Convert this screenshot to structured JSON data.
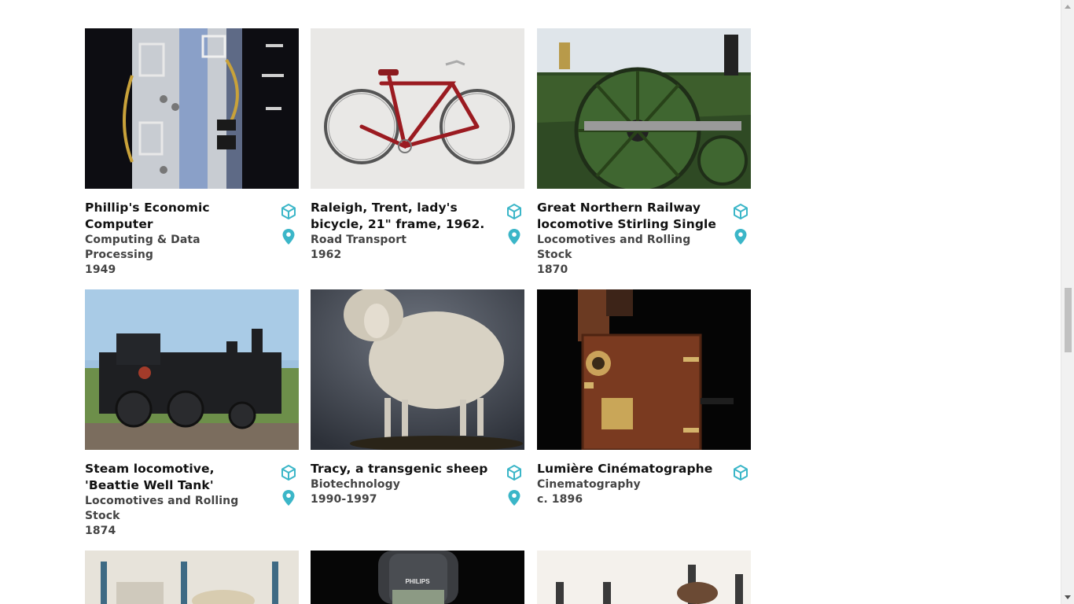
{
  "accent_color": "#3bb6c8",
  "cards": [
    {
      "title": "Phillip's Economic Computer",
      "category": "Computing & Data Processing",
      "date": "1949",
      "has_3d": true,
      "has_location": true
    },
    {
      "title": "Raleigh, Trent, lady's bicycle, 21\" frame, 1962.",
      "category": "Road Transport",
      "date": "1962",
      "has_3d": true,
      "has_location": true
    },
    {
      "title": "Great Northern Railway locomotive Stirling Single",
      "category": "Locomotives and Rolling Stock",
      "date": "1870",
      "has_3d": true,
      "has_location": true
    },
    {
      "title": "Steam locomotive, 'Beattie Well Tank'",
      "category": "Locomotives and Rolling Stock",
      "date": "1874",
      "has_3d": true,
      "has_location": true
    },
    {
      "title": "Tracy, a transgenic sheep",
      "category": "Biotechnology",
      "date": "1990-1997",
      "has_3d": true,
      "has_location": true
    },
    {
      "title": "Lumière Cinématographe",
      "category": "Cinematography",
      "date": "c. 1896",
      "has_3d": true,
      "has_location": false
    }
  ],
  "partial_cards": [
    {
      "image_text": "PHILIPS"
    }
  ],
  "icons": {
    "view_3d": "cube-3d-icon",
    "location": "map-pin-icon"
  }
}
